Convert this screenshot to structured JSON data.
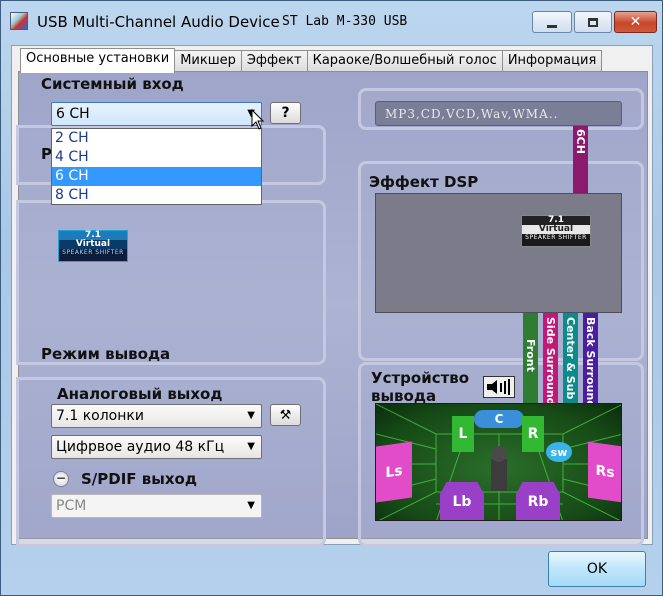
{
  "window": {
    "title": "USB Multi-Channel Audio Device",
    "subtitle": "ST Lab M-330 USB",
    "min_icon": "minimize-icon",
    "max_icon": "maximize-icon",
    "close_icon": "close-icon"
  },
  "tabs": [
    {
      "label": "Основные установки",
      "active": true
    },
    {
      "label": "Микшер"
    },
    {
      "label": "Эффект"
    },
    {
      "label": "Караоке/Волшебный голос"
    },
    {
      "label": "Информация"
    }
  ],
  "system_input": {
    "heading": "Системный вход",
    "selected": "6 CH",
    "help_label": "?",
    "options": [
      "2 CH",
      "4 CH",
      "6 CH",
      "8 CH"
    ],
    "highlighted": "6 CH"
  },
  "peek_heading_letter": "Р",
  "source_box": "MP3,CD,VCD,Wav,WMA..",
  "dsp": {
    "heading": "Эффект DSP",
    "badge": {
      "line1": "7.1",
      "line2": "Virtual",
      "line3": "SPEAKER SHIFTER"
    }
  },
  "left_badge": {
    "line1": "7.1",
    "line2": "Virtual",
    "line3": "SPEAKER SHIFTER"
  },
  "channel_labels": {
    "six_ch": "6CH",
    "front": "Front",
    "side_surround": "Side Surround",
    "center_sub": "Center & Sub",
    "back_surround": "Back Surround"
  },
  "colors": {
    "six_ch": "#8b1a6c",
    "front": "#2e7d32",
    "side_surround": "#c2187a",
    "center_sub": "#0d8a8a",
    "back_surround": "#4a1ea0"
  },
  "output_mode": {
    "heading": "Режим вывода",
    "analog_heading": "Аналоговый выход",
    "analog_select": "7.1 колонки",
    "digital_select": "Цифрвое аудио 48 кГц",
    "spdif_heading": "S/PDIF выход",
    "spdif_select": "PCM"
  },
  "device": {
    "heading_line1": "Устройство",
    "heading_line2": "вывода",
    "speakers": {
      "c": "C",
      "l": "L",
      "r": "R",
      "sw": "sw",
      "ls": "Ls",
      "rs": "Rs",
      "lb": "Lb",
      "rb": "Rb"
    }
  },
  "ok_label": "OK"
}
